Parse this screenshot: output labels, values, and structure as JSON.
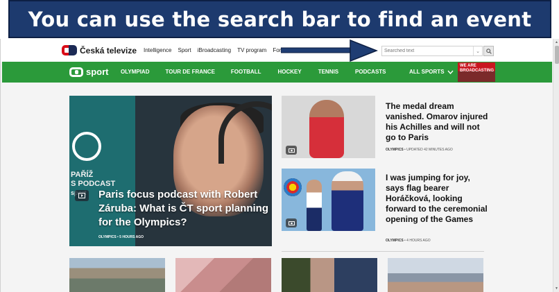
{
  "banner": {
    "text": "You can use the search bar to find an event"
  },
  "topnav": {
    "logo_text": "Česká televize",
    "links": [
      "Intelligence",
      "Sport",
      "iBroadcasting",
      "TV program",
      "For ki"
    ],
    "search_placeholder": "Searched text"
  },
  "sportnav": {
    "logo_text": "sport",
    "links": [
      "OLYMPIAD",
      "TOUR DE FRANCE",
      "FOOTBALL",
      "HOCKEY",
      "TENNIS",
      "PODCASTS"
    ],
    "all_sports": "ALL SPORTS",
    "broadcast_line1": "WE ARE",
    "broadcast_line2": "BROADCASTING"
  },
  "hero": {
    "podcast_label_1": "PAŘÍŽ",
    "podcast_label_2": "S PODCAST",
    "podcast_label_3": "sport",
    "title": "Paris focus podcast with Robert Záruba: What is ČT sport planning for the Olympics?",
    "meta": "OLYMPICS • 5 HOURS AGO"
  },
  "articles": [
    {
      "title": "The medal dream vanished. Omarov injured his Achilles and will not go to Paris",
      "meta_tag": "OLYMPICS",
      "meta_rest": "• UPDATED   42 MINUTES AGO"
    },
    {
      "title": "I was jumping for joy, says flag bearer Horáčková, looking forward to the ceremonial opening of the Games",
      "meta_tag": "OLYMPICS",
      "meta_rest": "• 4 HOURS AGO"
    }
  ],
  "colors": {
    "banner": "#1d3a6e",
    "sport_green": "#2b9a3a",
    "ct_red": "#d90c17"
  }
}
